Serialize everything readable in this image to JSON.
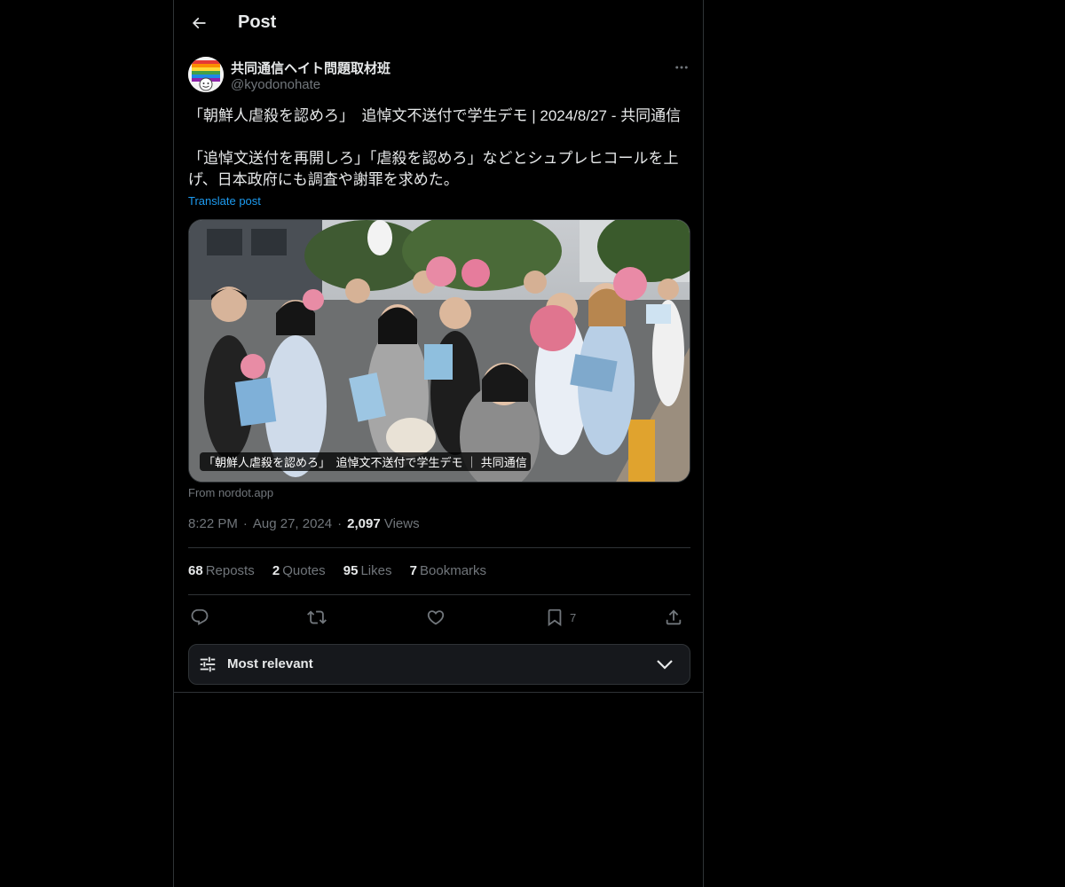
{
  "header": {
    "back_icon": "arrow-left-icon",
    "title": "Post"
  },
  "author": {
    "name": "共同通信ヘイト問題取材班",
    "handle": "@kyodonohate",
    "avatar_icon": "rainbow-hate-badge-avatar"
  },
  "post": {
    "text": "「朝鮮人虐殺を認めろ」　追悼文不送付で学生デモ | 2024/8/27 - 共同通信\n\n「追悼文送付を再開しろ」「虐殺を認めろ」などとシュプレヒコールを上げ、日本政府にも調査や謝罪を求めた。",
    "translate_label": "Translate post"
  },
  "card": {
    "caption": "「朝鮮人虐殺を認めろ」　追悼文不送付で学生デモ ｜ 共同通信",
    "source": "From nordot.app"
  },
  "meta": {
    "time": "8:22 PM",
    "date": "Aug 27, 2024",
    "views_count": "2,097",
    "views_label": "Views"
  },
  "stats": [
    {
      "count": "68",
      "label": "Reposts"
    },
    {
      "count": "2",
      "label": "Quotes"
    },
    {
      "count": "95",
      "label": "Likes"
    },
    {
      "count": "7",
      "label": "Bookmarks"
    }
  ],
  "actions": {
    "reply_icon": "reply-icon",
    "repost_icon": "repost-icon",
    "like_icon": "heart-icon",
    "bookmark_icon": "bookmark-icon",
    "bookmark_count": "7",
    "share_icon": "share-icon"
  },
  "sort": {
    "label": "Most relevant",
    "icon": "sliders-icon",
    "chevron": "chevron-down-icon"
  },
  "colors": {
    "background": "#000000",
    "text_primary": "#e7e9ea",
    "text_secondary": "#71767b",
    "accent": "#1d9bf0",
    "border": "#2f3336"
  }
}
